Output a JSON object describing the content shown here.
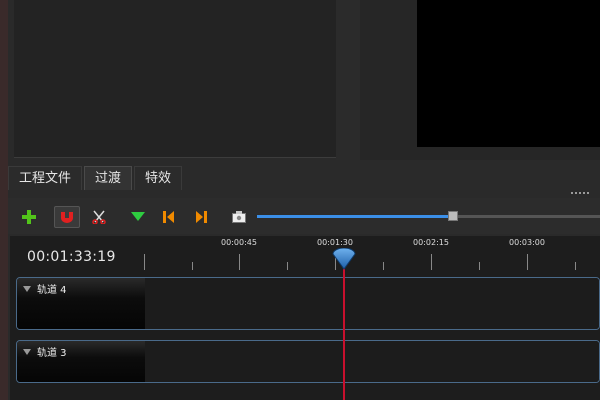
{
  "tabs": [
    {
      "label": "工程文件"
    },
    {
      "label": "过渡"
    },
    {
      "label": "特效"
    }
  ],
  "toolbar": {
    "icons": [
      "add-icon",
      "magnet-icon",
      "razor-icon",
      "marker-icon",
      "jump-start-icon",
      "jump-end-icon",
      "center-playhead-icon"
    ],
    "zoom_level": 0.57
  },
  "timeline": {
    "current_time": "00:01:33:19",
    "ruler_labels": [
      "00:00:45",
      "00:01:30",
      "00:02:15",
      "00:03:00"
    ],
    "tracks": [
      {
        "name": "轨道 4"
      },
      {
        "name": "轨道 3"
      }
    ]
  },
  "colors": {
    "accent": "#3b8fe8",
    "playhead": "#c8102e",
    "add": "#52c41a",
    "marker": "#2ecc40",
    "jump": "#f08a00"
  }
}
